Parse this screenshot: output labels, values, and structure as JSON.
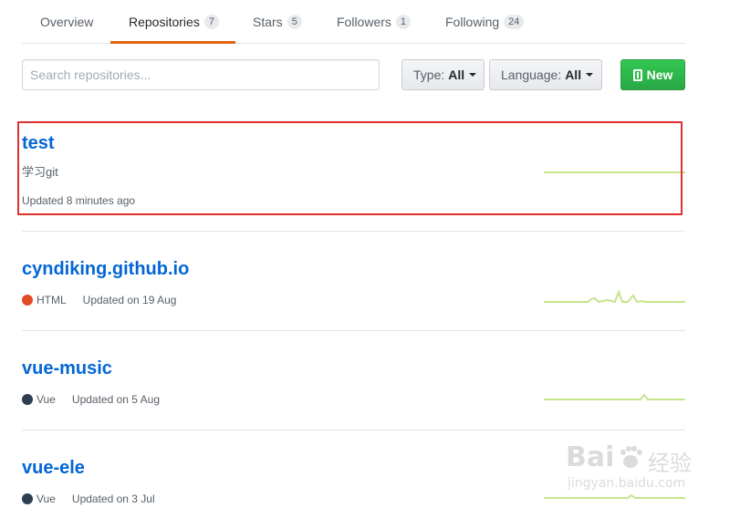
{
  "tabs": [
    {
      "label": "Overview",
      "count": ""
    },
    {
      "label": "Repositories",
      "count": "7"
    },
    {
      "label": "Stars",
      "count": "5"
    },
    {
      "label": "Followers",
      "count": "1"
    },
    {
      "label": "Following",
      "count": "24"
    }
  ],
  "filters": {
    "search_placeholder": "Search repositories...",
    "type_label": "Type:",
    "type_value": "All",
    "language_label": "Language:",
    "language_value": "All",
    "new_label": "New"
  },
  "repos": [
    {
      "name": "test",
      "description": "学习git",
      "language": "",
      "language_color": "",
      "updated": "Updated 8 minutes ago"
    },
    {
      "name": "cyndiking.github.io",
      "description": "",
      "language": "HTML",
      "language_color": "#e34c26",
      "updated": "Updated on 19 Aug"
    },
    {
      "name": "vue-music",
      "description": "",
      "language": "Vue",
      "language_color": "#2c3e50",
      "updated": "Updated on 5 Aug"
    },
    {
      "name": "vue-ele",
      "description": "",
      "language": "Vue",
      "language_color": "#2c3e50",
      "updated": "Updated on 3 Jul"
    }
  ],
  "colors": {
    "link": "#0366d6",
    "tab_underline": "#e36209",
    "new_button": "#28a745",
    "sparkline": "#c6e48b",
    "highlight_box": "#e03131"
  },
  "watermark": {
    "line1": "Bai",
    "line2": "经验",
    "line3": "jingyan.baidu.com"
  }
}
